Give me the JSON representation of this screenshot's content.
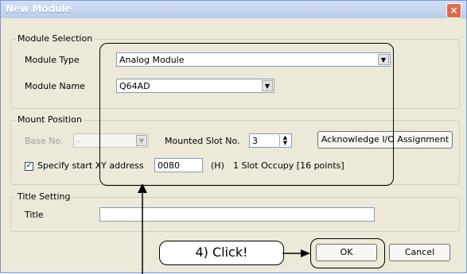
{
  "window": {
    "title": "New Module",
    "close_glyph": "×"
  },
  "module_selection": {
    "group_label": "Module Selection",
    "type_label": "Module Type",
    "type_value": "Analog Module",
    "name_label": "Module Name",
    "name_value": "Q64AD"
  },
  "mount_position": {
    "group_label": "Mount Position",
    "base_label": "Base No.",
    "base_value": "-",
    "slot_label": "Mounted Slot No.",
    "slot_value": "3",
    "ack_button": "Acknowledge I/O Assignment",
    "checkbox_checked": true,
    "xy_label": "Specify start XY address",
    "xy_value": "0080",
    "hex_label": "(H)",
    "occupy_label": "1 Slot Occupy [16 points]"
  },
  "title_setting": {
    "group_label": "Title Setting",
    "title_label": "Title",
    "title_value": ""
  },
  "buttons": {
    "ok": "OK",
    "cancel": "Cancel"
  },
  "annotation": {
    "callout": "4) Click!"
  }
}
